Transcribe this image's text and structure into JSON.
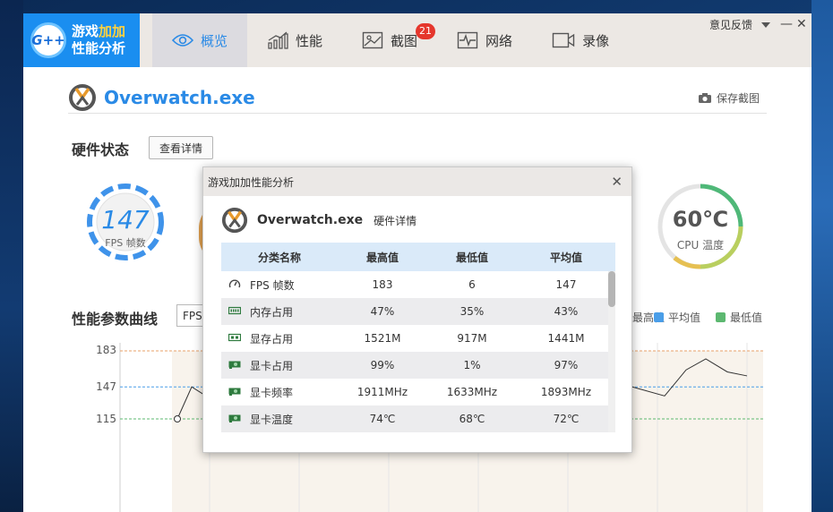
{
  "logo": {
    "badge": "G++",
    "line1_a": "游戏",
    "line1_b": "加加",
    "line2": "性能分析"
  },
  "nav": [
    {
      "label": "概览",
      "icon": "eye-icon",
      "active": true
    },
    {
      "label": "性能",
      "icon": "bar-chart-icon",
      "active": false
    },
    {
      "label": "截图",
      "icon": "image-icon",
      "active": false,
      "badge": "21"
    },
    {
      "label": "网络",
      "icon": "pulse-icon",
      "active": false
    },
    {
      "label": "录像",
      "icon": "video-icon",
      "active": false
    }
  ],
  "window": {
    "feedback": "意见反馈",
    "minimize": "—",
    "close": "✕"
  },
  "app": {
    "name": "Overwatch.exe",
    "save_screenshot": "保存截图"
  },
  "hardware": {
    "title": "硬件状态",
    "detail_button": "查看详情"
  },
  "gauges": {
    "fps": {
      "value": "147",
      "label": "FPS 帧数"
    },
    "cpu": {
      "value": "60℃",
      "label": "CPU 温度"
    }
  },
  "curve": {
    "title": "性能参数曲线",
    "select_value": "FPS",
    "legend": [
      {
        "label": "最高值",
        "color": "#e8a06a"
      },
      {
        "label": "平均值",
        "color": "#4a9ee8"
      },
      {
        "label": "最低值",
        "color": "#5cb870"
      }
    ]
  },
  "chart_data": {
    "type": "line",
    "y_ticks": [
      183,
      147,
      115
    ],
    "reference_lines": {
      "max": 183,
      "avg": 147,
      "min": 115
    },
    "visible_points_left": [
      115,
      147,
      138
    ],
    "visible_points_right": [
      147,
      138,
      164,
      175,
      162,
      158
    ]
  },
  "dialog": {
    "title": "游戏加加性能分析",
    "close": "✕",
    "app_name": "Overwatch.exe",
    "subtitle": "硬件详情",
    "columns": [
      "分类名称",
      "最高值",
      "最低值",
      "平均值"
    ],
    "rows": [
      {
        "icon": "gauge-icon",
        "name": "FPS 帧数",
        "max": "183",
        "min": "6",
        "avg": "147"
      },
      {
        "icon": "memory-icon",
        "name": "内存占用",
        "max": "47%",
        "min": "35%",
        "avg": "43%"
      },
      {
        "icon": "vram-icon",
        "name": "显存占用",
        "max": "1521M",
        "min": "917M",
        "avg": "1441M"
      },
      {
        "icon": "gpu-icon",
        "name": "显卡占用",
        "max": "99%",
        "min": "1%",
        "avg": "97%"
      },
      {
        "icon": "gpu-icon",
        "name": "显卡频率",
        "max": "1911MHz",
        "min": "1633MHz",
        "avg": "1893MHz"
      },
      {
        "icon": "gpu-icon",
        "name": "显卡温度",
        "max": "74℃",
        "min": "68℃",
        "avg": "72℃"
      }
    ]
  }
}
